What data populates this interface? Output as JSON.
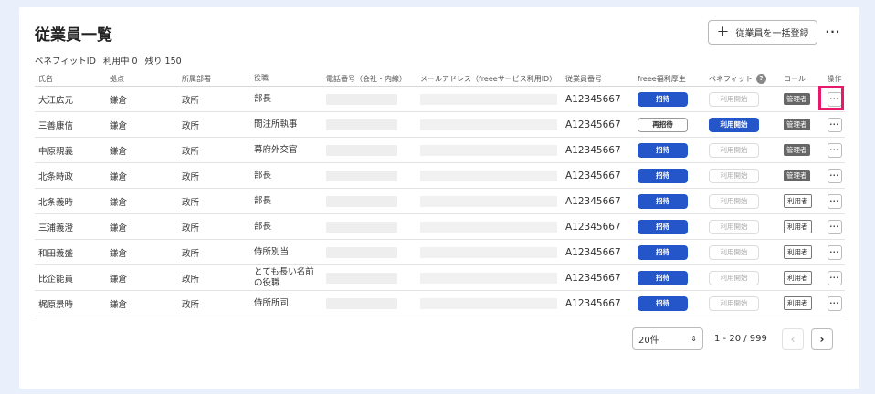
{
  "page": {
    "title": "従業員一覧"
  },
  "toolbar": {
    "bulk_register_label": "従業員を一括登録",
    "more_label": "···"
  },
  "summary": {
    "benefit_id": "ベネフィットID",
    "in_use": "利用中 0",
    "remaining": "残り 150"
  },
  "table": {
    "headers": {
      "name": "氏名",
      "base": "拠点",
      "dept": "所属部署",
      "title": "役職",
      "phone": "電話番号（会社・内線）",
      "mail": "メールアドレス（freeeサービス利用ID）",
      "employee_id": "従業員番号",
      "welfare": "freee福利厚生",
      "benefit": "ベネフィット",
      "role": "ロール",
      "ops": "操作"
    },
    "rows": [
      {
        "name": "大江広元",
        "base": "鎌倉",
        "dept": "政所",
        "title": "部長",
        "employee_id": "A12345667",
        "welfare": "招待",
        "benefit": "利用開始",
        "role": "管理者"
      },
      {
        "name": "三善康信",
        "base": "鎌倉",
        "dept": "政所",
        "title": "問注所執事",
        "employee_id": "A12345667",
        "welfare": "再招待",
        "benefit": "利用開始",
        "role": "管理者"
      },
      {
        "name": "中原親義",
        "base": "鎌倉",
        "dept": "政所",
        "title": "幕府外交官",
        "employee_id": "A12345667",
        "welfare": "招待",
        "benefit": "利用開始",
        "role": "管理者"
      },
      {
        "name": "北条時政",
        "base": "鎌倉",
        "dept": "政所",
        "title": "部長",
        "employee_id": "A12345667",
        "welfare": "招待",
        "benefit": "利用開始",
        "role": "管理者"
      },
      {
        "name": "北条義時",
        "base": "鎌倉",
        "dept": "政所",
        "title": "部長",
        "employee_id": "A12345667",
        "welfare": "招待",
        "benefit": "利用開始",
        "role": "利用者"
      },
      {
        "name": "三浦義澄",
        "base": "鎌倉",
        "dept": "政所",
        "title": "部長",
        "employee_id": "A12345667",
        "welfare": "招待",
        "benefit": "利用開始",
        "role": "利用者"
      },
      {
        "name": "和田義盛",
        "base": "鎌倉",
        "dept": "政所",
        "title": "侍所別当",
        "employee_id": "A12345667",
        "welfare": "招待",
        "benefit": "利用開始",
        "role": "利用者"
      },
      {
        "name": "比企能員",
        "base": "鎌倉",
        "dept": "政所",
        "title": "とても長い名前の役職",
        "employee_id": "A12345667",
        "welfare": "招待",
        "benefit": "利用開始",
        "role": "利用者"
      },
      {
        "name": "梶原景時",
        "base": "鎌倉",
        "dept": "政所",
        "title": "侍所所司",
        "employee_id": "A12345667",
        "welfare": "招待",
        "benefit": "利用開始",
        "role": "利用者"
      }
    ]
  },
  "pagination": {
    "per_page": "20件",
    "range": "1 - 20 / 999",
    "prev": "‹",
    "next": "›"
  },
  "colors": {
    "primary": "#2456c9",
    "highlight": "#e8196b",
    "admin_badge": "#666666"
  }
}
